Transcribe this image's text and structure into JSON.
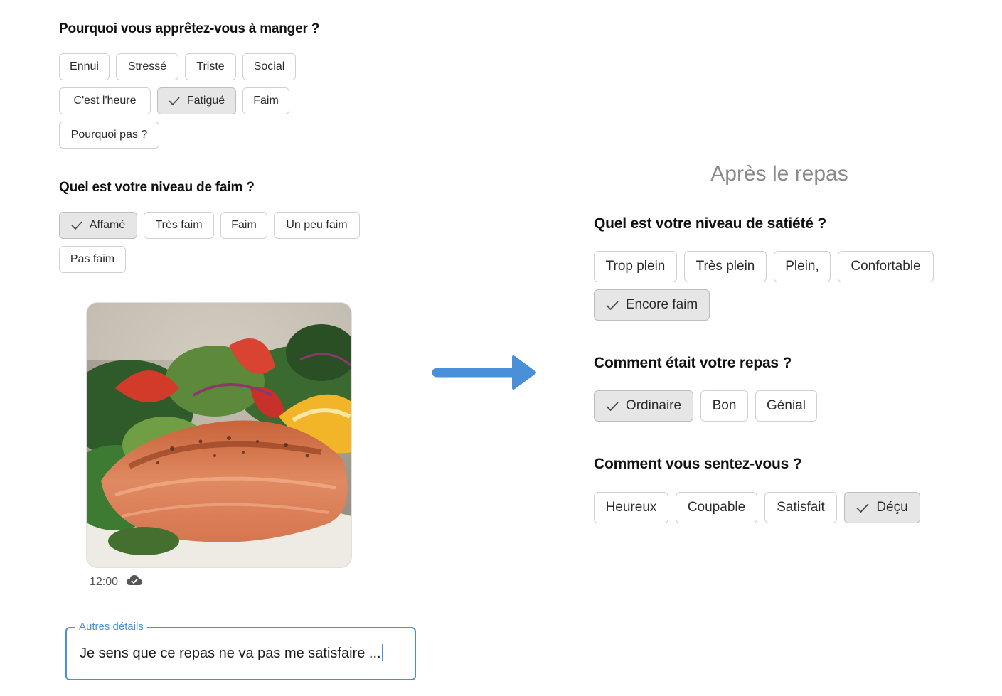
{
  "before": {
    "why_question": "Pourquoi vous apprêtez-vous à manger ?",
    "why_options": [
      "Ennui",
      "Stressé",
      "Triste",
      "Social",
      "C'est l'heure",
      "Fatigué",
      "Faim",
      "Pourquoi pas ?"
    ],
    "why_selected": "Fatigué",
    "hunger_question": "Quel est votre niveau de faim ?",
    "hunger_options": [
      "Affamé",
      "Très faim",
      "Faim",
      "Un peu faim",
      "Pas faim"
    ],
    "hunger_selected": "Affamé",
    "photo_time": "12:00",
    "photo_sync_icon": "cloud-check-icon",
    "details_label": "Autres détails",
    "details_value": "Je sens que ce repas ne va pas me satisfaire ..."
  },
  "arrow_icon": "arrow-right-icon",
  "after": {
    "section_title": "Après le repas",
    "satiety_question": "Quel est votre niveau de satiété ?",
    "satiety_options": [
      "Trop plein",
      "Très plein",
      "Plein,",
      "Confortable",
      "Encore faim"
    ],
    "satiety_selected": "Encore faim",
    "meal_question": "Comment était votre repas ?",
    "meal_options": [
      "Ordinaire",
      "Bon",
      "Génial"
    ],
    "meal_selected": "Ordinaire",
    "feeling_question": "Comment vous sentez-vous ?",
    "feeling_options": [
      "Heureux",
      "Coupable",
      "Satisfait",
      "Déçu"
    ],
    "feeling_selected": "Déçu"
  },
  "colors": {
    "accent": "#4a90d9",
    "chip_selected_bg": "#e6e6e6",
    "chip_border": "#d0d0d0",
    "section_title": "#8a8a8a"
  }
}
